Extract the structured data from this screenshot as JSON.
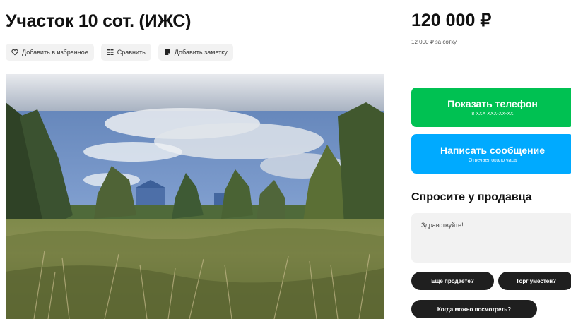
{
  "listing": {
    "title": "Участок 10 сот. (ИЖС)"
  },
  "actions": {
    "favorite_label": "Добавить в избранное",
    "compare_label": "Сравнить",
    "note_label": "Добавить заметку"
  },
  "price": {
    "value": "120 000 ₽",
    "per_unit": "12 000 ₽ за сотку"
  },
  "buttons": {
    "phone_label": "Показать телефон",
    "phone_sub": "8 XXX XXX-XX-XX",
    "message_label": "Написать сообщение",
    "message_sub": "Отвечает около часа"
  },
  "ask_seller": {
    "title": "Спросите у продавца",
    "message_value": "Здравствуйте!",
    "chips": [
      "Ещё продаёте?",
      "Торг уместен?",
      "Когда можно посмотреть?"
    ]
  },
  "colors": {
    "green": "#00c152",
    "blue": "#00aaff",
    "chip_dark": "#1f1f1f"
  },
  "icons": {
    "favorite": "heart-icon",
    "compare": "compare-icon",
    "note": "note-icon"
  }
}
